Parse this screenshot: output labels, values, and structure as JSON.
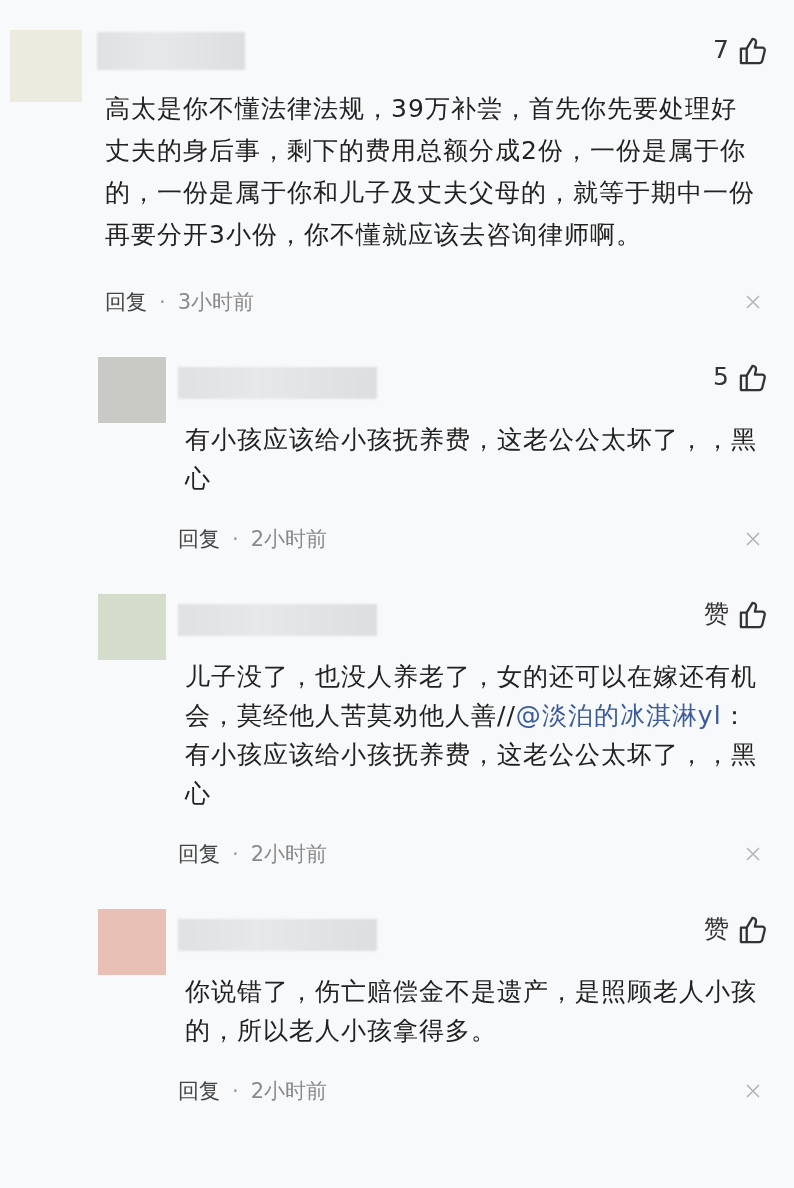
{
  "comments": [
    {
      "color": "#ecebdf",
      "likes": "7",
      "body": [
        {
          "kind": "text",
          "text": "高太是你不懂法律法规，39万补尝，首先你先要处理好丈夫的身后事，剩下的费用总额分成2份，一份是属于你的，一份是属于你和儿子及丈夫父母的，就等于期中一份再要分开3小份，你不懂就应该去咨询律师啊。"
        }
      ],
      "reply_label": "回复",
      "separator": "·",
      "time": "3小时前",
      "replies": [
        {
          "color": "#c9c9c6",
          "likes": "5",
          "body": [
            {
              "kind": "text",
              "text": "有小孩应该给小孩抚养费，这老公公太坏了，，黑心"
            }
          ],
          "reply_label": "回复",
          "separator": "·",
          "time": "2小时前"
        },
        {
          "color": "#d4dccb",
          "likes": "赞",
          "body": [
            {
              "kind": "text",
              "text": "儿子没了，也没人养老了，女的还可以在嫁还有机会，莫经他人苦莫劝他人善//"
            },
            {
              "kind": "mention",
              "text": "@淡泊的冰淇淋yl"
            },
            {
              "kind": "text",
              "text": "：有小孩应该给小孩抚养费，这老公公太坏了，，黑心"
            }
          ],
          "reply_label": "回复",
          "separator": "·",
          "time": "2小时前"
        },
        {
          "color": "#e8c0b6",
          "likes": "赞",
          "body": [
            {
              "kind": "text",
              "text": "你说错了，伤亡赔偿金不是遗产，是照顾老人小孩的，所以老人小孩拿得多。"
            }
          ],
          "reply_label": "回复",
          "separator": "·",
          "time": "2小时前"
        }
      ]
    }
  ]
}
